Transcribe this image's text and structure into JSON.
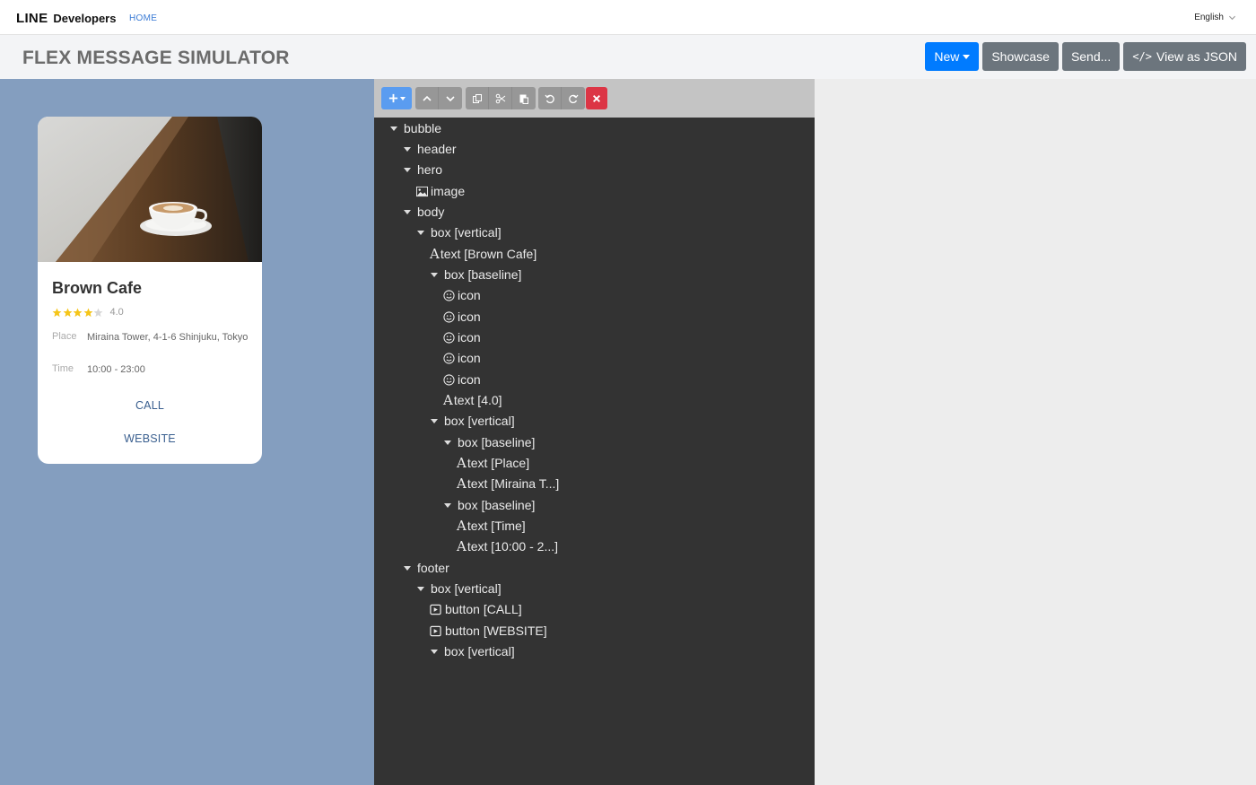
{
  "topnav": {
    "brand_line": "LINE",
    "brand_dev": "Developers",
    "home": "HOME",
    "language": "English"
  },
  "header": {
    "title": "FLEX MESSAGE SIMULATOR",
    "buttons": {
      "new": "New",
      "showcase": "Showcase",
      "send": "Send...",
      "view_json": "View as JSON"
    }
  },
  "preview": {
    "name": "Brown Cafe",
    "rating": "4.0",
    "stars": 4,
    "place_label": "Place",
    "place_value": "Miraina Tower, 4-1-6 Shinjuku, Tokyo",
    "time_label": "Time",
    "time_value": "10:00 - 23:00",
    "call": "CALL",
    "website": "WEBSITE"
  },
  "toolbar": {
    "add": "add-icon",
    "up": "arrow-up-icon",
    "down": "arrow-down-icon",
    "copy": "copy-icon",
    "cut": "cut-icon",
    "paste": "paste-icon",
    "undo": "undo-icon",
    "redo": "redo-icon",
    "delete": "delete-icon"
  },
  "tree": {
    "nodes": [
      {
        "label": "bubble",
        "icon": "caret-down"
      },
      {
        "label": "header",
        "icon": "caret-down"
      },
      {
        "label": "hero",
        "icon": "caret-down"
      },
      {
        "label": "image",
        "icon": "image"
      },
      {
        "label": "body",
        "icon": "caret-down"
      },
      {
        "label": "box [vertical]",
        "icon": "caret-down"
      },
      {
        "label": "text [Brown Cafe]",
        "icon": "text"
      },
      {
        "label": "box [baseline]",
        "icon": "caret-down"
      },
      {
        "label": "icon",
        "icon": "smiley"
      },
      {
        "label": "icon",
        "icon": "smiley"
      },
      {
        "label": "icon",
        "icon": "smiley"
      },
      {
        "label": "icon",
        "icon": "smiley"
      },
      {
        "label": "icon",
        "icon": "smiley"
      },
      {
        "label": "text [4.0]",
        "icon": "text"
      },
      {
        "label": "box [vertical]",
        "icon": "caret-down"
      },
      {
        "label": "box [baseline]",
        "icon": "caret-down"
      },
      {
        "label": "text [Place]",
        "icon": "text"
      },
      {
        "label": "text [Miraina T...]",
        "icon": "text"
      },
      {
        "label": "box [baseline]",
        "icon": "caret-down"
      },
      {
        "label": "text [Time]",
        "icon": "text"
      },
      {
        "label": "text [10:00 - 2...]",
        "icon": "text"
      },
      {
        "label": "footer",
        "icon": "caret-down"
      },
      {
        "label": "box [vertical]",
        "icon": "caret-down"
      },
      {
        "label": "button [CALL]",
        "icon": "button"
      },
      {
        "label": "button [WEBSITE]",
        "icon": "button"
      },
      {
        "label": "box [vertical]",
        "icon": "caret-down"
      }
    ]
  },
  "colors": {
    "primary": "#007bff",
    "secondary": "#6c757d",
    "danger": "#dc3545",
    "preview_bg": "#849ebf",
    "tree_bg": "#333333",
    "star": "#f5c518"
  }
}
